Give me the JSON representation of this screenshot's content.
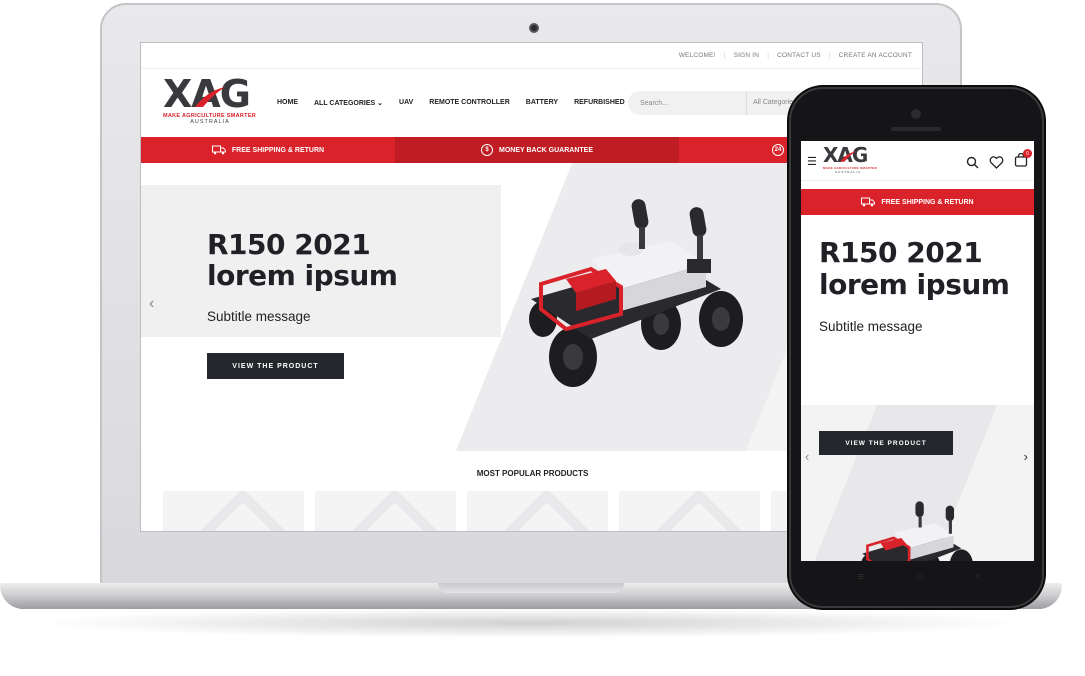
{
  "brand": {
    "logo_text": "XAG",
    "tagline": "MAKE AGRICULTURE SMARTER",
    "region": "AUSTRALIA",
    "accent_color": "#d9222a",
    "dark_color": "#24272c"
  },
  "top_links": [
    "WELCOME!",
    "SIGN IN",
    "CONTACT US",
    "CREATE AN ACCOUNT"
  ],
  "nav": [
    "HOME",
    "ALL CATEGORIES",
    "UAV",
    "REMOTE CONTROLLER",
    "BATTERY",
    "REFURBISHED"
  ],
  "search": {
    "placeholder": "Search...",
    "category": "All Categories"
  },
  "promo_bar": {
    "shipping": "FREE SHIPPING & RETURN",
    "money_back": "MONEY BACK GUARANTEE",
    "support_badge": "24"
  },
  "hero": {
    "title_line1": "R150 2021",
    "title_line2": "lorem ipsum",
    "subtitle": "Subtitle message",
    "cta": "VIEW THE PRODUCT"
  },
  "popular": {
    "title": "MOST POPULAR PRODUCTS"
  },
  "cart": {
    "count": "0"
  },
  "icons": {
    "truck": "truck-icon",
    "dollar": "dollar-icon",
    "search": "search-icon",
    "heart": "heart-icon",
    "bag": "shopping-bag-icon",
    "menu": "menu-icon"
  }
}
